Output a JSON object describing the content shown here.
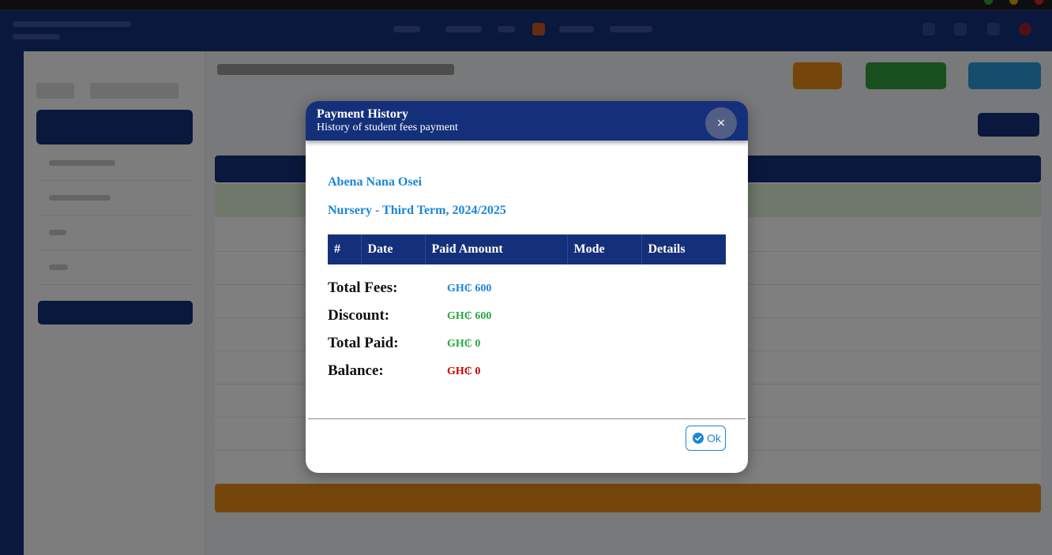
{
  "modal": {
    "title": "Payment History",
    "subtitle": "History of student fees payment",
    "close_label": "×",
    "student_name": "Abena Nana Osei",
    "class_term": "Nursery - Third Term, 2024/2025",
    "table": {
      "columns": [
        "#",
        "Date",
        "Paid Amount",
        "Mode",
        "Details"
      ],
      "rows": []
    },
    "summary": {
      "total_fees_label": "Total Fees:",
      "total_fees_value": "GH₵ 600",
      "discount_label": "Discount:",
      "discount_value": "GH₵ 600",
      "total_paid_label": "Total Paid:",
      "total_paid_value": "GH₵ 0",
      "balance_label": "Balance:",
      "balance_value": "GH₵ 0"
    },
    "ok_label": "Ok"
  },
  "colors": {
    "primary": "#15307a",
    "accent_blue": "#1a86d8",
    "success_green": "#28a745",
    "danger_red": "#cc0000",
    "warning_orange": "#e88c12"
  },
  "icons": {
    "close": "close-icon",
    "ok": "check-circle-icon"
  }
}
